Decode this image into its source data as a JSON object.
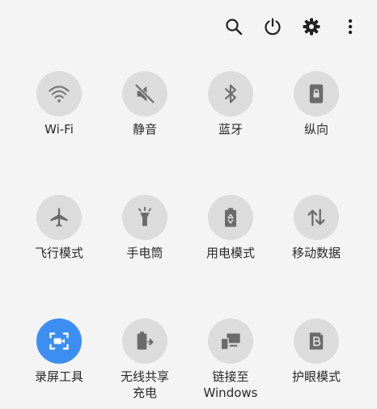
{
  "top_actions": [
    {
      "name": "search-icon"
    },
    {
      "name": "power-icon"
    },
    {
      "name": "gear-icon"
    },
    {
      "name": "more-vert-icon"
    }
  ],
  "tiles": [
    {
      "label": "Wi-Fi",
      "icon": "wifi-icon",
      "active": false
    },
    {
      "label": "静音",
      "icon": "mute-icon",
      "active": false
    },
    {
      "label": "蓝牙",
      "icon": "bluetooth-icon",
      "active": false
    },
    {
      "label": "纵向",
      "icon": "portrait-lock-icon",
      "active": false
    },
    {
      "label": "飞行模式",
      "icon": "airplane-icon",
      "active": false
    },
    {
      "label": "手电筒",
      "icon": "flashlight-icon",
      "active": false
    },
    {
      "label": "用电模式",
      "icon": "battery-saver-icon",
      "active": false
    },
    {
      "label": "移动数据",
      "icon": "mobile-data-icon",
      "active": false
    },
    {
      "label": "录屏工具",
      "icon": "screen-recorder-icon",
      "active": true
    },
    {
      "label": "无线共享\n充电",
      "icon": "wireless-powershare-icon",
      "active": false
    },
    {
      "label": "链接至\nWindows",
      "icon": "link-to-windows-icon",
      "active": false
    },
    {
      "label": "护眼模式",
      "icon": "eye-comfort-icon",
      "active": false
    }
  ],
  "colors": {
    "active": "#3d8ef2",
    "inactive": "#dcdcdc",
    "icon": "#6b6b6b"
  }
}
